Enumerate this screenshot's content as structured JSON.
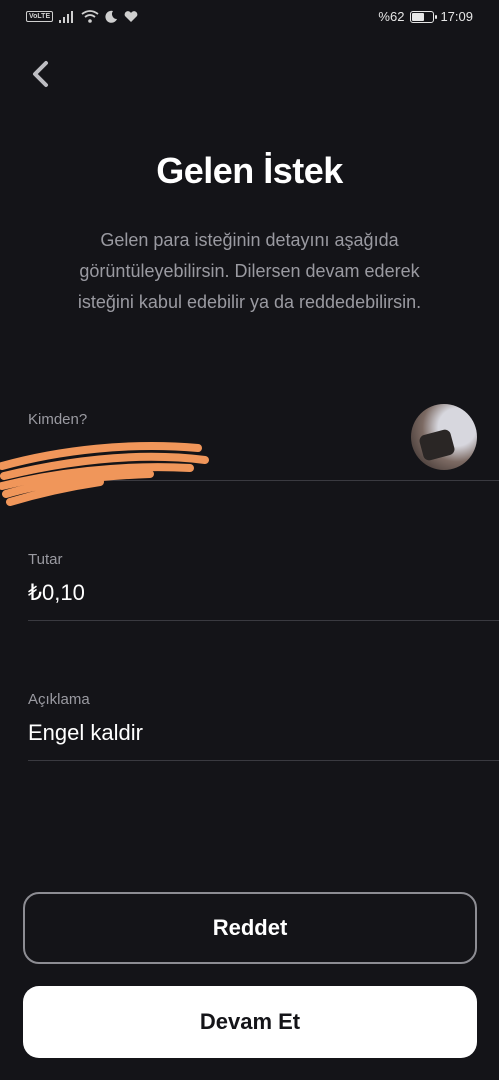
{
  "status_bar": {
    "network_badge": "VoLTE",
    "battery_text": "%62",
    "battery_level": 0.62,
    "time": "17:09"
  },
  "header": {
    "title": "Gelen İstek",
    "subtitle": "Gelen para isteğinin detayını aşağıda görüntüleyebilirsin. Dilersen devam ederek isteğini kabul edebilir ya da reddedebilirsin."
  },
  "fields": {
    "sender": {
      "label": "Kimden?",
      "value": ""
    },
    "amount": {
      "label": "Tutar",
      "value": "₺0,10"
    },
    "note": {
      "label": "Açıklama",
      "value": "Engel kaldir"
    }
  },
  "actions": {
    "reject_label": "Reddet",
    "continue_label": "Devam Et"
  },
  "colors": {
    "background": "#141418",
    "text_primary": "#ffffff",
    "text_secondary": "#9a9aa1",
    "redaction": "#f0965a"
  }
}
